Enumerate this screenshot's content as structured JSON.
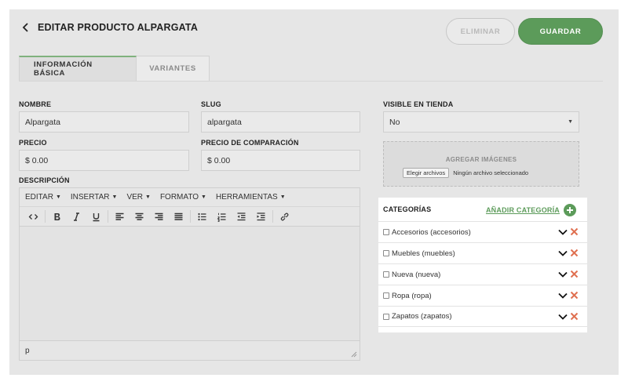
{
  "header": {
    "title": "EDITAR PRODUCTO ALPARGATA",
    "delete_label": "ELIMINAR",
    "save_label": "GUARDAR"
  },
  "tabs": [
    {
      "label": "INFORMACIÓN BÁSICA",
      "active": true
    },
    {
      "label": "VARIANTES",
      "active": false
    }
  ],
  "form": {
    "name_label": "NOMBRE",
    "name_value": "Alpargata",
    "slug_label": "SLUG",
    "slug_value": "alpargata",
    "visible_label": "VISIBLE EN TIENDA",
    "visible_value": "No",
    "price_label": "PRECIO",
    "price_value": "$ 0.00",
    "compare_label": "PRECIO DE COMPARACIÓN",
    "compare_value": "$ 0.00",
    "description_label": "DESCRIPCIÓN"
  },
  "images": {
    "label": "AGREGAR IMÁGENES",
    "file_button": "Elegir archivos",
    "file_status": "Ningún archivo seleccionado"
  },
  "editor": {
    "menus": [
      "EDITAR",
      "INSERTAR",
      "VER",
      "FORMATO",
      "HERRAMIENTAS"
    ],
    "status_path": "p",
    "toolbar_icons": [
      "code-icon",
      "bold-icon",
      "italic-icon",
      "underline-icon",
      "align-left-icon",
      "align-center-icon",
      "align-right-icon",
      "align-justify-icon",
      "bullet-list-icon",
      "numbered-list-icon",
      "outdent-icon",
      "indent-icon",
      "link-icon"
    ]
  },
  "categories": {
    "title": "CATEGORÍAS",
    "add_label": "AÑADIR CATEGORÍA",
    "items": [
      {
        "label": "Accesorios (accesorios)"
      },
      {
        "label": "Muebles (muebles)"
      },
      {
        "label": "Nueva (nueva)"
      },
      {
        "label": "Ropa (ropa)"
      },
      {
        "label": "Zapatos (zapatos)"
      }
    ]
  },
  "colors": {
    "accent_green": "#5c9b5a",
    "delete_red": "#e07050"
  }
}
